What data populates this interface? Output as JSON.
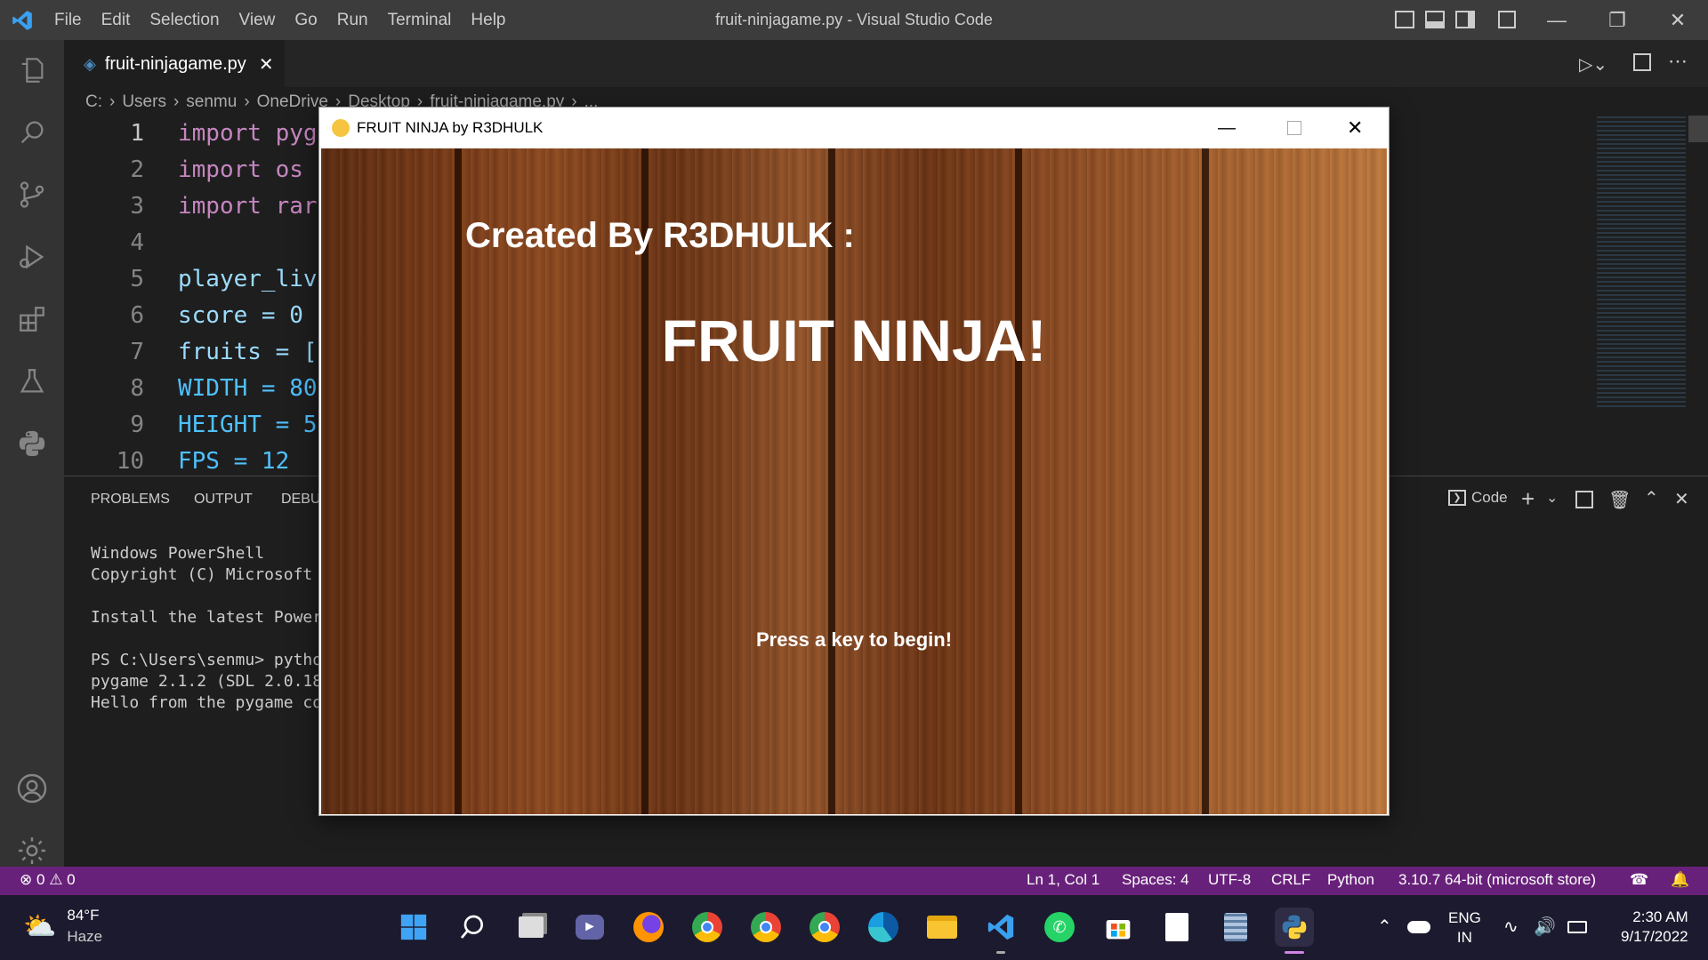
{
  "titlebar": {
    "menu": [
      "File",
      "Edit",
      "Selection",
      "View",
      "Go",
      "Run",
      "Terminal",
      "Help"
    ],
    "title": "fruit-ninjagame.py - Visual Studio Code"
  },
  "tab": {
    "label": "fruit-ninjagame.py"
  },
  "breadcrumb": [
    "C:",
    "Users",
    "senmu",
    "OneDrive",
    "Desktop",
    "fruit-ninjagame.py",
    "..."
  ],
  "editor": {
    "lines": [
      {
        "n": "1",
        "code": "import pyg"
      },
      {
        "n": "2",
        "code": "import os"
      },
      {
        "n": "3",
        "code": "import rar"
      },
      {
        "n": "4",
        "code": ""
      },
      {
        "n": "5",
        "code": "player_liv"
      },
      {
        "n": "6",
        "code": "score = 0"
      },
      {
        "n": "7",
        "code": "fruits = ["
      },
      {
        "n": "8",
        "code": "WIDTH = 80"
      },
      {
        "n": "9",
        "code": "HEIGHT = 5"
      },
      {
        "n": "10",
        "code": "FPS = 12"
      }
    ]
  },
  "panel": {
    "tabs": [
      "PROBLEMS",
      "OUTPUT",
      "DEBU"
    ],
    "terminal_label": "Code",
    "terminal_lines": [
      "Windows PowerShell",
      "Copyright (C) Microsoft",
      "",
      "Install the latest Power",
      "",
      "PS C:\\Users\\senmu> pytho",
      "pygame 2.1.2 (SDL 2.0.18",
      "Hello from the pygame co"
    ]
  },
  "statusbar": {
    "errors": "0",
    "warnings": "0",
    "position": "Ln 1, Col 1",
    "spaces": "Spaces: 4",
    "encoding": "UTF-8",
    "eol": "CRLF",
    "language": "Python",
    "interpreter": "3.10.7 64-bit (microsoft store)"
  },
  "game": {
    "window_title": "FRUIT NINJA by R3DHULK",
    "credit": "Created By R3DHULK :",
    "headline": "FRUIT NINJA!",
    "prompt": "Press a key to begin!"
  },
  "taskbar": {
    "weather_temp": "84°F",
    "weather_desc": "Haze",
    "lang": "ENG",
    "region": "IN",
    "time": "2:30 AM",
    "date": "9/17/2022"
  },
  "colors": {
    "statusbar": "#68217a",
    "accent": "#007acc"
  }
}
